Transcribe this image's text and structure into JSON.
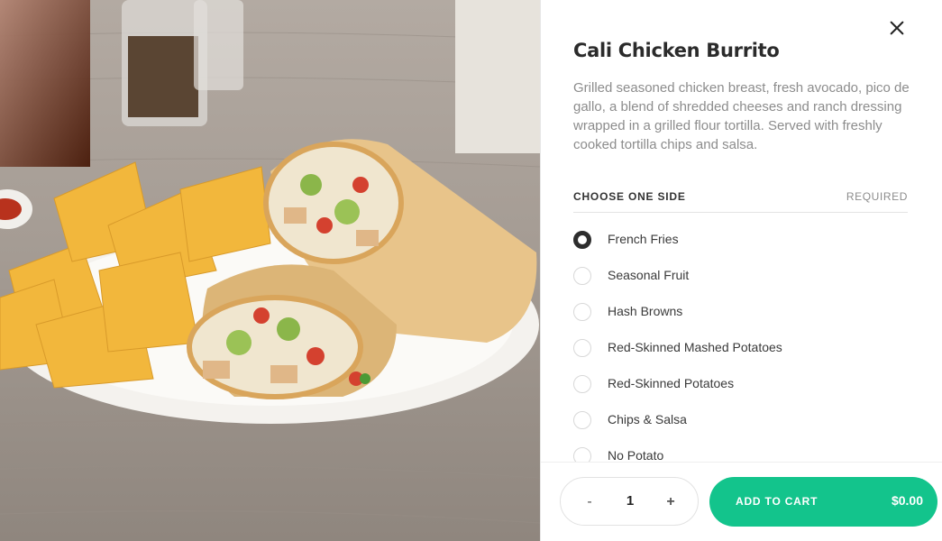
{
  "item": {
    "title": "Cali Chicken Burrito",
    "description": "Grilled seasoned chicken breast, fresh avocado, pico de gallo, a blend of shredded cheeses and ranch dressing wrapped in a grilled flour tortilla. Served with freshly cooked tortilla chips and salsa."
  },
  "side_section": {
    "title": "CHOOSE ONE SIDE",
    "required_label": "REQUIRED",
    "selected_index": 0,
    "options": [
      "French Fries",
      "Seasonal Fruit",
      "Hash Browns",
      "Red-Skinned Mashed Potatoes",
      "Red-Skinned Potatoes",
      "Chips & Salsa",
      "No Potato"
    ]
  },
  "footer": {
    "minus_label": "-",
    "quantity": "1",
    "plus_label": "+",
    "add_to_cart_label": "ADD TO CART",
    "price": "$0.00"
  },
  "icons": {
    "close": "close-icon",
    "photo": "burrito-photo"
  },
  "colors": {
    "accent": "#13c48c",
    "selected_radio": "#2d2d2d",
    "text_muted": "#8c8c8c"
  }
}
